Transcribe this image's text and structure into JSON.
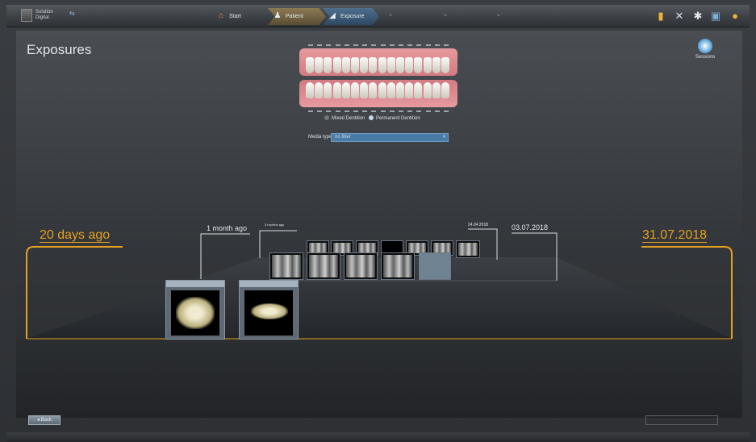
{
  "app": {
    "name_line1": "Solution",
    "name_line2": "Digital"
  },
  "nav": {
    "start": "Start",
    "patient": "Patient",
    "exposure": "Exposure",
    "step4": "",
    "step5": "",
    "step6": ""
  },
  "page": {
    "title": "Exposures",
    "sessions_label": "Sessions"
  },
  "dentition": {
    "mixed_label": "Mixed Dentition",
    "permanent_label": "Permanent Dentition",
    "permanent_selected": true
  },
  "media": {
    "label": "Media types",
    "value": "no filter"
  },
  "timeline": {
    "left_label": "20 days ago",
    "right_label": "31.07.2018",
    "label_1month": "1 month ago",
    "label_3months": "3 months ago",
    "label_date1": "24.04.2018",
    "label_date2": "03.07.2018"
  },
  "footer": {
    "back_label": "Back",
    "right_button": "",
    "status_left": ""
  },
  "colors": {
    "accent": "#e3a11e",
    "patient_tab": "#8c7a55",
    "exposure_tab": "#4e6f8e"
  },
  "icons": [
    "home-icon",
    "patient-icon",
    "exposure-icon",
    "folder-icon",
    "tools-icon",
    "settings-icon",
    "window-icon",
    "user-status-icon",
    "sessions-icon",
    "back-arrow-icon"
  ]
}
